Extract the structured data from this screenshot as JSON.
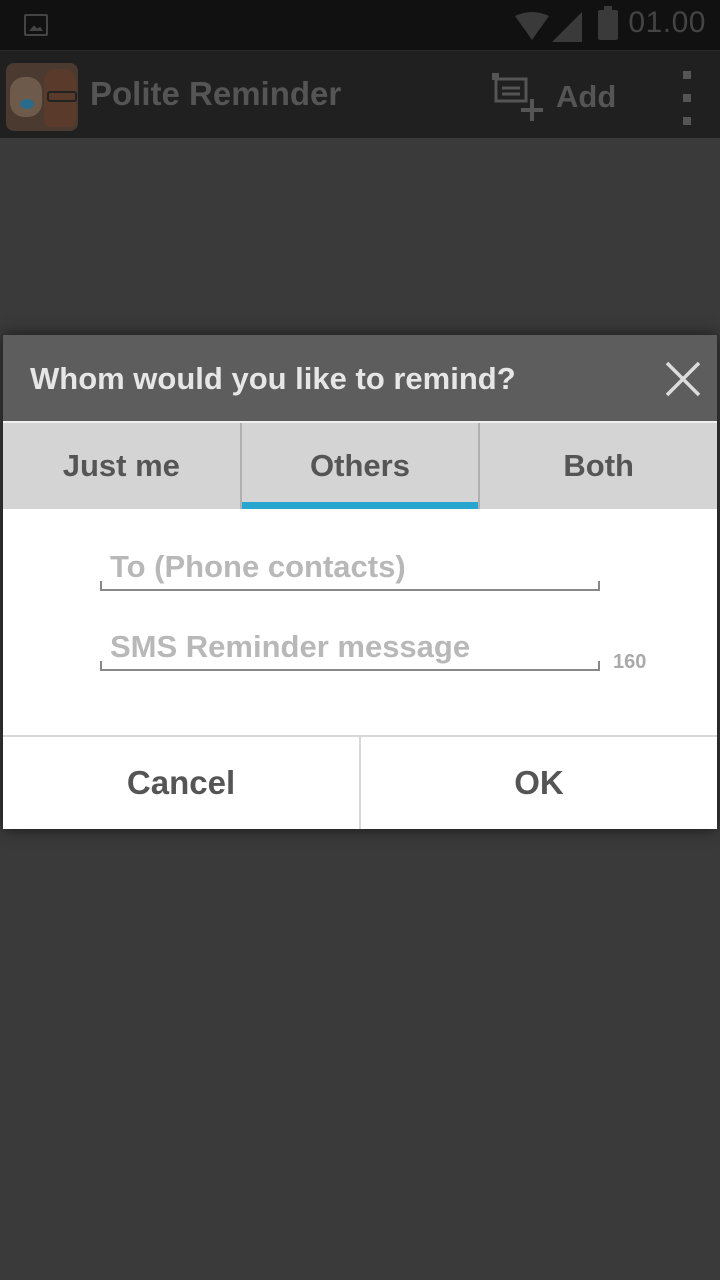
{
  "status_bar": {
    "time": "01.00",
    "icons": [
      "image-icon",
      "wifi-icon",
      "signal-icon",
      "battery-icon"
    ]
  },
  "action_bar": {
    "title": "Polite Reminder",
    "add_label": "Add",
    "icons": [
      "app-icon",
      "add-note-icon",
      "overflow-menu-icon"
    ]
  },
  "dialog": {
    "title": "Whom would you like to remind?",
    "tabs": [
      {
        "label": "Just me",
        "selected": false
      },
      {
        "label": "Others",
        "selected": true
      },
      {
        "label": "Both",
        "selected": false
      }
    ],
    "to_field": {
      "value": "",
      "placeholder": "To (Phone contacts)"
    },
    "message_field": {
      "value": "",
      "placeholder": "SMS Reminder message"
    },
    "char_counter": "160",
    "cancel_label": "Cancel",
    "ok_label": "OK"
  },
  "colors": {
    "accent": "#27a6d0",
    "background": "#3a3a3a",
    "action_bar": "#202020",
    "dialog_header": "#5d5d5d",
    "tabs_background": "#d4d4d4"
  }
}
